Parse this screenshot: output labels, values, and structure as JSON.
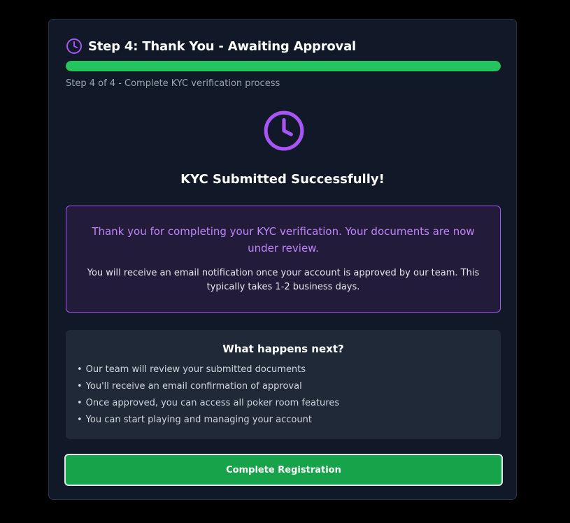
{
  "header": {
    "title": "Step 4: Thank You - Awaiting Approval",
    "icon": "clock-icon",
    "icon_color": "#a855f7"
  },
  "progress": {
    "value": 1.0,
    "color": "#22c55e",
    "caption": "Step 4 of 4 - Complete KYC verification process"
  },
  "status": {
    "icon": "clock-icon",
    "title": "KYC Submitted Successfully!"
  },
  "notice": {
    "main": "Thank you for completing your KYC verification. Your documents are now under review.",
    "sub": "You will receive an email notification once your account is approved by our team. This typically takes 1-2 business days.",
    "accent": "#a855f7"
  },
  "next_steps": {
    "title": "What happens next?",
    "bullet": "•",
    "items": [
      "Our team will review your submitted documents",
      "You'll receive an email confirmation of approval",
      "Once approved, you can access all poker room features",
      "You can start playing and managing your account"
    ]
  },
  "actions": {
    "complete_label": "Complete Registration",
    "complete_color": "#16a34a"
  }
}
